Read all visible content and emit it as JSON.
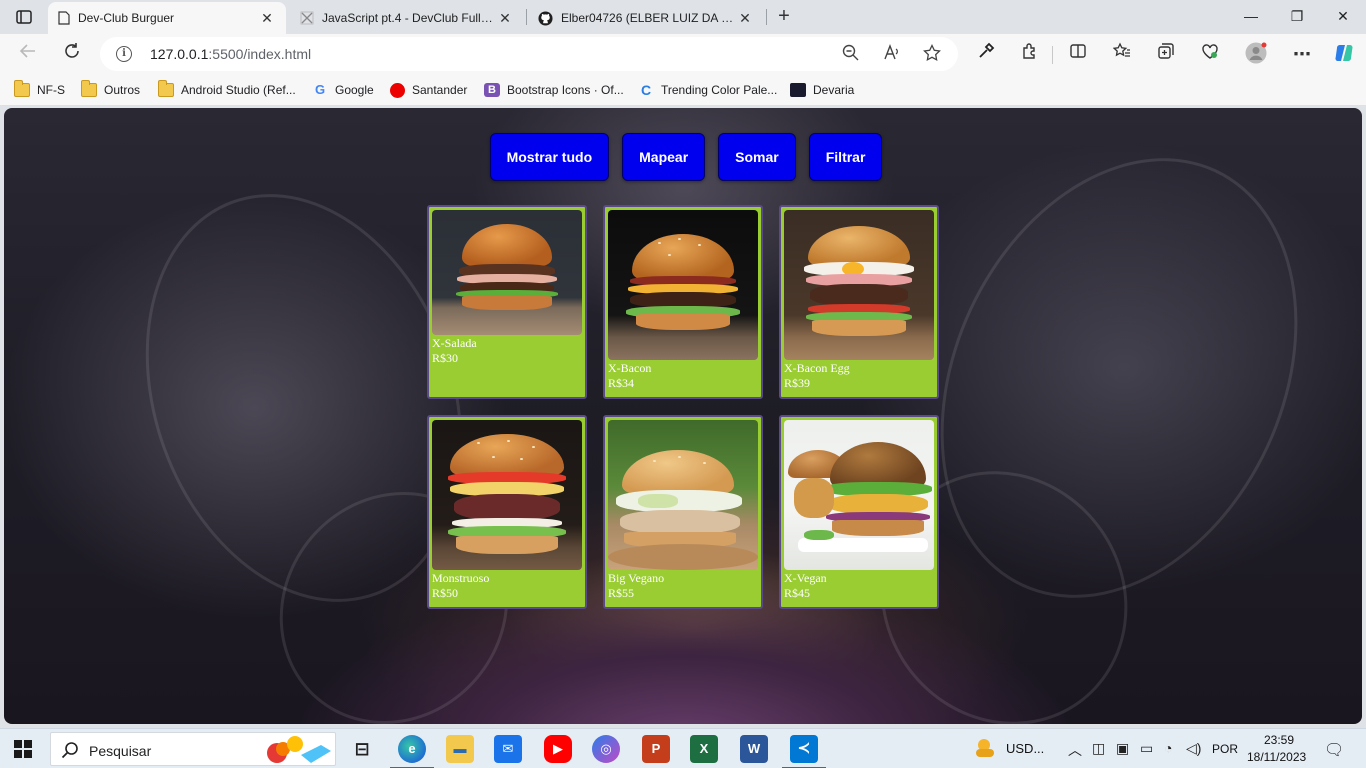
{
  "browser": {
    "tabs": [
      {
        "title": "Dev-Club Burguer",
        "active": true
      },
      {
        "title": "JavaScript pt.4 - DevClub Full Sta",
        "active": false
      },
      {
        "title": "Elber04726 (ELBER LUIZ DA ROSA",
        "active": false
      }
    ],
    "close_glyph": "✕",
    "new_tab_glyph": "+",
    "window_controls": {
      "minimize": "—",
      "restore": "❐",
      "close": "✕"
    },
    "address": {
      "host": "127.0.0.1",
      "path": ":5500/index.html"
    },
    "bookmarks": [
      {
        "label": "NF-S",
        "icon": "folder-icon"
      },
      {
        "label": "Outros",
        "icon": "folder-icon"
      },
      {
        "label": "Android Studio (Ref...",
        "icon": "folder-icon"
      },
      {
        "label": "Google",
        "icon": "google-icon",
        "glyph": "G"
      },
      {
        "label": "Santander",
        "icon": "santander-icon"
      },
      {
        "label": "Bootstrap Icons · Of...",
        "icon": "bootstrap-icon",
        "glyph": "B"
      },
      {
        "label": "Trending Color Pale...",
        "icon": "trending-color-icon",
        "glyph": "C"
      },
      {
        "label": "Devaria",
        "icon": "devaria-icon"
      }
    ]
  },
  "page": {
    "buttons": [
      {
        "label": "Mostrar tudo"
      },
      {
        "label": "Mapear"
      },
      {
        "label": "Somar"
      },
      {
        "label": "Filtrar"
      }
    ],
    "accent_button_color": "#0000ee",
    "card_color": "#9acd32",
    "products": [
      {
        "name": "X-Salada",
        "price": "R$30"
      },
      {
        "name": "X-Bacon",
        "price": "R$34"
      },
      {
        "name": "X-Bacon Egg",
        "price": "R$39"
      },
      {
        "name": "Monstruoso",
        "price": "R$50"
      },
      {
        "name": "Big Vegano",
        "price": "R$55"
      },
      {
        "name": "X-Vegan",
        "price": "R$45"
      }
    ]
  },
  "taskbar": {
    "search_placeholder": "Pesquisar",
    "weather": "USD...",
    "language": "POR",
    "time": "23:59",
    "date": "18/11/2023",
    "apps": [
      {
        "name": "edge",
        "glyph": "e"
      },
      {
        "name": "explorer",
        "glyph": "▬"
      },
      {
        "name": "mail",
        "glyph": "✉"
      },
      {
        "name": "youtube",
        "glyph": "▶"
      },
      {
        "name": "copilot",
        "glyph": "◎"
      },
      {
        "name": "powerpoint",
        "glyph": "P"
      },
      {
        "name": "excel",
        "glyph": "X"
      },
      {
        "name": "word",
        "glyph": "W"
      },
      {
        "name": "vscode",
        "glyph": "≺"
      }
    ]
  }
}
